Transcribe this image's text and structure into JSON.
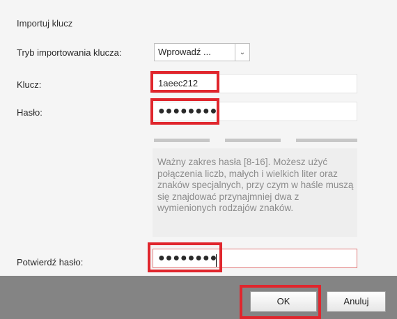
{
  "dialog": {
    "title": "Importuj klucz",
    "mode_label": "Tryb importowania klucza:",
    "mode_value": "Wprowadź ...",
    "key_label": "Klucz:",
    "key_value": "1aeec212",
    "password_label": "Hasło:",
    "password_value": "●●●●●●●●",
    "hint": "Ważny zakres hasła [8-16]. Możesz użyć połączenia liczb, małych i wielkich liter oraz znaków specjalnych, przy czym w haśle muszą się znajdować przynajmniej dwa z wymienionych rodzajów znaków.",
    "confirm_label": "Potwierdź hasło:",
    "confirm_value": "●●●●●●●●"
  },
  "buttons": {
    "ok": "OK",
    "cancel": "Anuluj"
  },
  "colors": {
    "highlight": "#e0262d",
    "footer": "#848484",
    "field_error": "#e07a7a"
  }
}
